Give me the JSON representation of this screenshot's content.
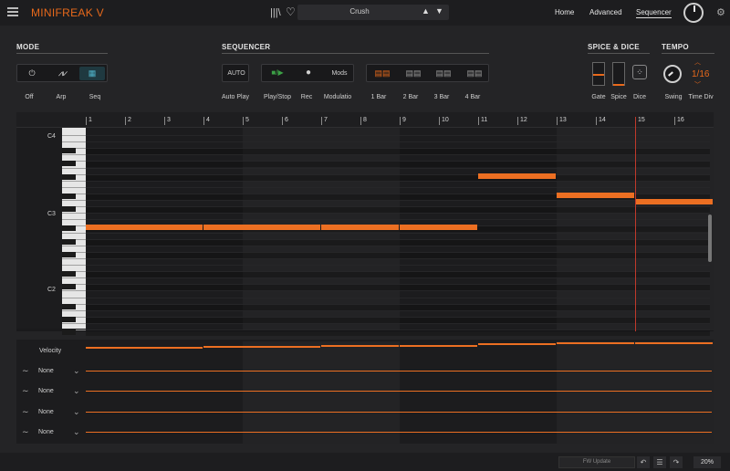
{
  "header": {
    "app_title": "MINIFREAK V",
    "preset_name": "Crush",
    "library_icon": "library-icon",
    "favorite_icon": "heart-icon",
    "nav": [
      "Home",
      "Advanced",
      "Sequencer"
    ],
    "active_tab": "Sequencer"
  },
  "mode": {
    "title": "MODE",
    "options": [
      "Off",
      "Arp",
      "Seq"
    ],
    "selected": "Seq"
  },
  "sequencer": {
    "title": "SEQUENCER",
    "auto_button": "AUTO",
    "mods_button": "Mods",
    "labels": [
      "Auto Play",
      "Play/Stop",
      "Rec",
      "Modulatio",
      "1 Bar",
      "2 Bar",
      "3 Bar",
      "4 Bar"
    ],
    "selected_length": "1 Bar"
  },
  "spice_dice": {
    "title": "SPICE & DICE",
    "labels": [
      "Gate",
      "Spice",
      "Dice"
    ]
  },
  "tempo": {
    "title": "TEMPO",
    "time_div_value": "1/16",
    "labels": [
      "Swing",
      "Time Div"
    ]
  },
  "piano_roll": {
    "steps": [
      "1",
      "2",
      "3",
      "4",
      "5",
      "6",
      "7",
      "8",
      "9",
      "10",
      "11",
      "12",
      "13",
      "14",
      "15",
      "16"
    ],
    "octave_labels": [
      "C4",
      "C3",
      "C2"
    ],
    "playhead_step": 15,
    "notes": [
      {
        "step_start": 1,
        "step_end": 3,
        "pitch": "C3"
      },
      {
        "step_start": 4,
        "step_end": 6,
        "pitch": "C3"
      },
      {
        "step_start": 7,
        "step_end": 8,
        "pitch": "C3"
      },
      {
        "step_start": 9,
        "step_end": 10,
        "pitch": "C3"
      },
      {
        "step_start": 11,
        "step_end": 12,
        "pitch": "G#3"
      },
      {
        "step_start": 13,
        "step_end": 14,
        "pitch": "F3"
      },
      {
        "step_start": 15,
        "step_end": 16,
        "pitch": "E3"
      }
    ]
  },
  "lanes": {
    "velocity_label": "Velocity",
    "mod_lanes": [
      "None",
      "None",
      "None",
      "None"
    ]
  },
  "footer": {
    "fw_update": "FW Update",
    "zoom": "20%"
  }
}
